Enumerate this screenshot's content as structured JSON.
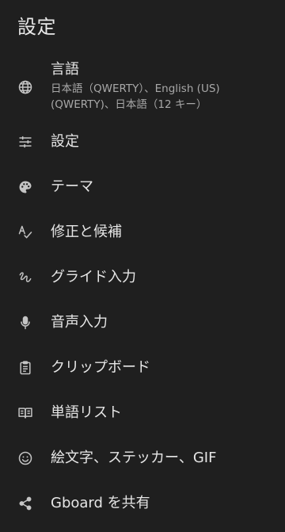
{
  "header": {
    "title": "設定"
  },
  "menu": {
    "items": [
      {
        "label": "言語",
        "subtitle_line1": "日本語（QWERTY）、English (US)",
        "subtitle_line2": "(QWERTY)、日本語（12 キー）",
        "icon": "globe-icon"
      },
      {
        "label": "設定",
        "icon": "tune-icon"
      },
      {
        "label": "テーマ",
        "icon": "palette-icon"
      },
      {
        "label": "修正と候補",
        "icon": "spellcheck-icon"
      },
      {
        "label": "グライド入力",
        "icon": "gesture-icon"
      },
      {
        "label": "音声入力",
        "icon": "mic-icon"
      },
      {
        "label": "クリップボード",
        "icon": "clipboard-icon"
      },
      {
        "label": "単語リスト",
        "icon": "dictionary-icon"
      },
      {
        "label": "絵文字、ステッカー、GIF",
        "icon": "emoji-icon"
      },
      {
        "label": "Gboard を共有",
        "icon": "share-icon"
      }
    ]
  },
  "colors": {
    "background": "#1f1f1f",
    "text_primary": "#e6e6e6",
    "text_secondary": "#a8a8a8",
    "icon": "#c4c4c4"
  }
}
